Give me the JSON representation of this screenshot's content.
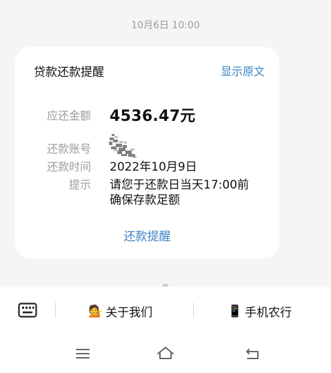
{
  "timestamp": "10月6日 10:00",
  "card": {
    "title": "贷款还款提醒",
    "show_original": "显示原文",
    "amount_label": "应还金额",
    "amount_value": "4536.47元",
    "account_label": "还款账号",
    "time_label": "还款时间",
    "time_value": "2022年10月9日",
    "tip_label": "提示",
    "tip_line1": "请您于还款日当天17:00前",
    "tip_line2": "确保存款足额",
    "remind_link": "还款提醒"
  },
  "menu": {
    "about_icon": "💁",
    "about_label": "关于我们",
    "mobile_icon": "📱",
    "mobile_label": "手机农行"
  },
  "icons": {
    "keyboard": "keyboard-icon",
    "menu": "hamburger-menu-icon",
    "home": "home-icon",
    "back": "back-icon"
  },
  "colors": {
    "accent": "#3b82c4",
    "label_gray": "#9c9c9c",
    "background": "#f5f5f5"
  }
}
